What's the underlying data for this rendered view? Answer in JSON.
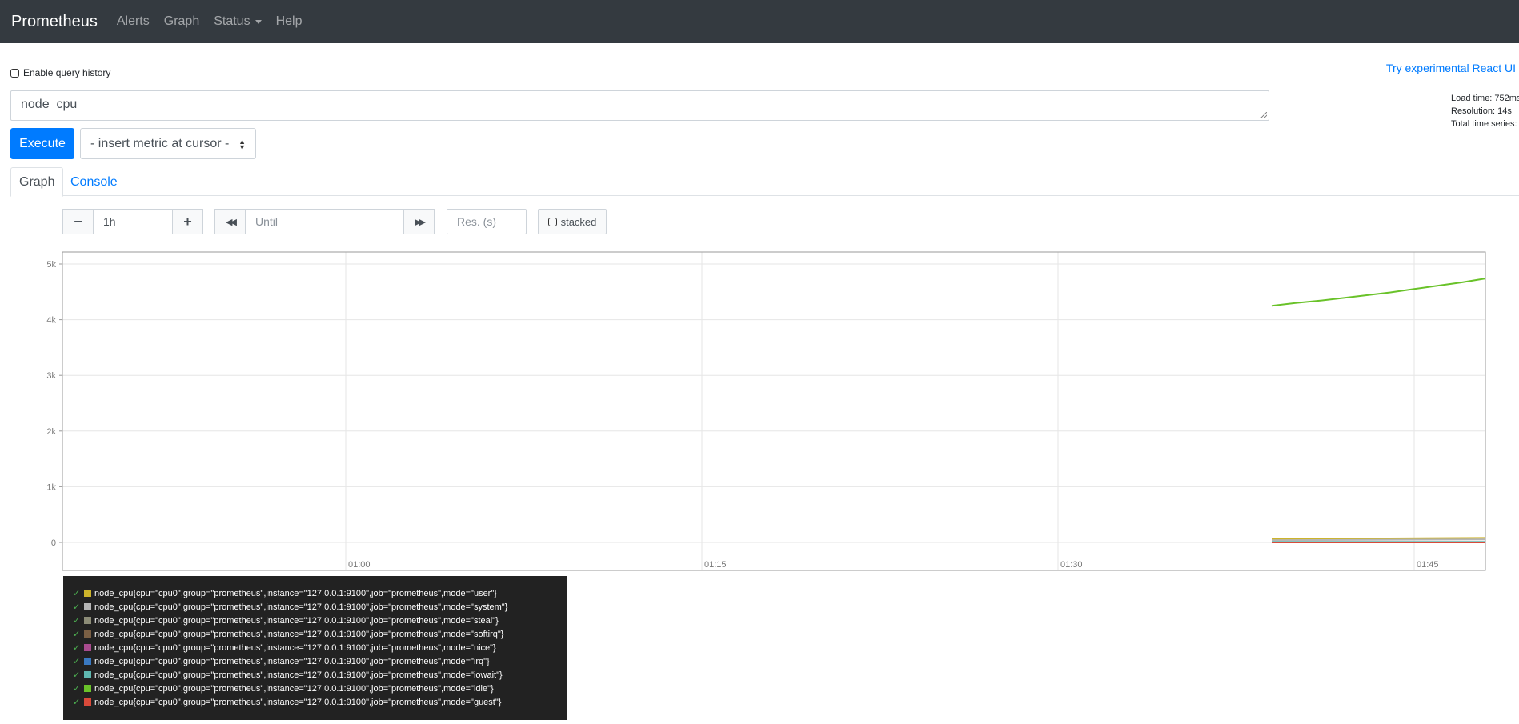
{
  "navbar": {
    "brand": "Prometheus",
    "items": [
      {
        "label": "Alerts"
      },
      {
        "label": "Graph"
      },
      {
        "label": "Status"
      },
      {
        "label": "Help"
      }
    ]
  },
  "query_history_label": "Enable query history",
  "react_link": "Try experimental React UI",
  "stats": {
    "load_time": "Load time: 752ms",
    "resolution": "Resolution: 14s",
    "total_series": "Total time series:"
  },
  "expression": "node_cpu",
  "execute_label": "Execute",
  "metric_select_label": "- insert metric at cursor -",
  "tabs": [
    {
      "label": "Graph"
    },
    {
      "label": "Console"
    }
  ],
  "controls": {
    "range_value": "1h",
    "until_placeholder": "Until",
    "res_placeholder": "Res. (s)",
    "stacked_label": "stacked"
  },
  "chart_data": {
    "type": "line",
    "ylim": [
      0,
      5200
    ],
    "y_ticks": [
      "0",
      "1k",
      "2k",
      "3k",
      "4k",
      "5k"
    ],
    "x_ticks": [
      "01:00",
      "01:15",
      "01:30",
      "01:45"
    ],
    "grid": true,
    "series": [
      {
        "name": "node_cpu{cpu=\"cpu0\",group=\"prometheus\",instance=\"127.0.0.1:9100\",job=\"prometheus\",mode=\"user\"}",
        "color": "#cdb42b",
        "x": [
          "01:39",
          "01:48"
        ],
        "values": [
          60,
          80
        ]
      },
      {
        "name": "node_cpu{cpu=\"cpu0\",group=\"prometheus\",instance=\"127.0.0.1:9100\",job=\"prometheus\",mode=\"system\"}",
        "color": "#b5b5b5",
        "x": [
          "01:39",
          "01:48"
        ],
        "values": [
          40,
          55
        ]
      },
      {
        "name": "node_cpu{cpu=\"cpu0\",group=\"prometheus\",instance=\"127.0.0.1:9100\",job=\"prometheus\",mode=\"steal\"}",
        "color": "#8c8c77",
        "x": [
          "01:39",
          "01:48"
        ],
        "values": [
          0,
          0
        ]
      },
      {
        "name": "node_cpu{cpu=\"cpu0\",group=\"prometheus\",instance=\"127.0.0.1:9100\",job=\"prometheus\",mode=\"softirq\"}",
        "color": "#7a5f44",
        "x": [
          "01:39",
          "01:48"
        ],
        "values": [
          5,
          5
        ]
      },
      {
        "name": "node_cpu{cpu=\"cpu0\",group=\"prometheus\",instance=\"127.0.0.1:9100\",job=\"prometheus\",mode=\"nice\"}",
        "color": "#a94b8f",
        "x": [
          "01:39",
          "01:48"
        ],
        "values": [
          0,
          0
        ]
      },
      {
        "name": "node_cpu{cpu=\"cpu0\",group=\"prometheus\",instance=\"127.0.0.1:9100\",job=\"prometheus\",mode=\"irq\"}",
        "color": "#3a79c1",
        "x": [
          "01:39",
          "01:48"
        ],
        "values": [
          0,
          0
        ]
      },
      {
        "name": "node_cpu{cpu=\"cpu0\",group=\"prometheus\",instance=\"127.0.0.1:9100\",job=\"prometheus\",mode=\"iowait\"}",
        "color": "#5fb8b0",
        "x": [
          "01:39",
          "01:48"
        ],
        "values": [
          10,
          12
        ]
      },
      {
        "name": "node_cpu{cpu=\"cpu0\",group=\"prometheus\",instance=\"127.0.0.1:9100\",job=\"prometheus\",mode=\"idle\"}",
        "color": "#69c229",
        "x": [
          "01:39",
          "01:40",
          "01:41",
          "01:42",
          "01:43",
          "01:44",
          "01:45",
          "01:46",
          "01:47",
          "01:48"
        ],
        "values": [
          4250,
          4300,
          4340,
          4390,
          4440,
          4490,
          4550,
          4610,
          4670,
          4740
        ]
      },
      {
        "name": "node_cpu{cpu=\"cpu0\",group=\"prometheus\",instance=\"127.0.0.1:9100\",job=\"prometheus\",mode=\"guest\"}",
        "color": "#d94a3a",
        "x": [
          "01:39",
          "01:48"
        ],
        "values": [
          0,
          0
        ]
      }
    ]
  }
}
